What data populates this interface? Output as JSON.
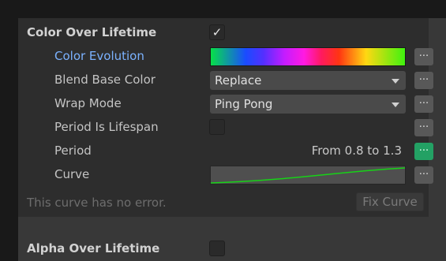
{
  "color_over_lifetime": {
    "title": "Color Over Lifetime",
    "enabled_mark": "✓",
    "properties": {
      "color_evolution": {
        "label": "Color Evolution"
      },
      "blend_base_color": {
        "label": "Blend Base Color",
        "value": "Replace"
      },
      "wrap_mode": {
        "label": "Wrap Mode",
        "value": "Ping Pong"
      },
      "period_is_lifespan": {
        "label": "Period Is Lifespan"
      },
      "period": {
        "label": "Period",
        "value": "From 0.8 to 1.3"
      },
      "curve": {
        "label": "Curve"
      }
    },
    "status_message": "This curve has no error.",
    "fix_button_label": "Fix Curve",
    "options_button_label": "..."
  },
  "alpha_over_lifetime": {
    "title": "Alpha Over Lifetime"
  },
  "colors": {
    "panel_bg": "#383838",
    "group_bg": "#2d2d2d",
    "highlight_label": "#7bb2ff",
    "active_options_button": "#23a164",
    "curve_line": "#17d217"
  }
}
